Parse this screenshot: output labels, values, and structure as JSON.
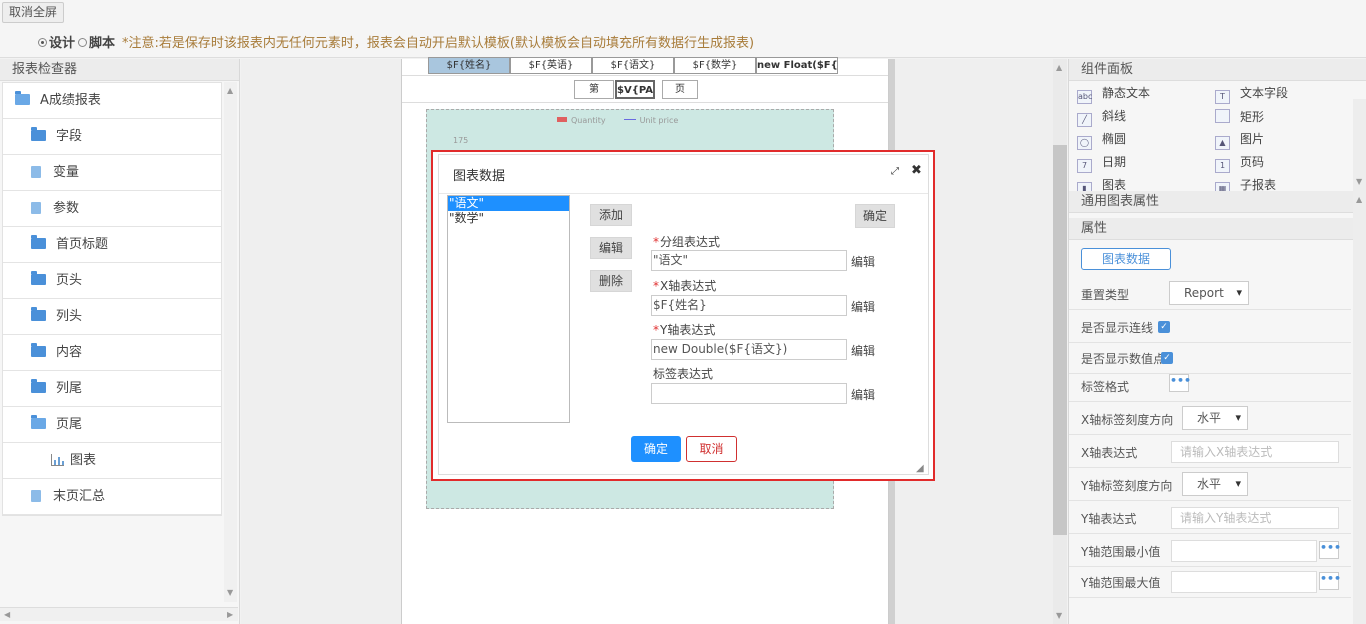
{
  "topbar": {
    "exit_fullscreen": "取消全屏",
    "mode_design": "设计",
    "mode_script": "脚本",
    "notice": "*注意:若是保存时该报表内无任何元素时，报表会自动开启默认模板(默认模板会自动填充所有数据行生成报表)"
  },
  "inspector": {
    "title": "报表检查器",
    "items": [
      {
        "label": "A成绩报表",
        "icon": "folder-open-icon",
        "level": 0
      },
      {
        "label": "字段",
        "icon": "folder-icon",
        "level": 1
      },
      {
        "label": "变量",
        "icon": "file-icon",
        "level": 1
      },
      {
        "label": "参数",
        "icon": "file-icon",
        "level": 1
      },
      {
        "label": "首页标题",
        "icon": "folder-icon",
        "level": 1
      },
      {
        "label": "页头",
        "icon": "folder-icon",
        "level": 1
      },
      {
        "label": "列头",
        "icon": "folder-icon",
        "level": 1
      },
      {
        "label": "内容",
        "icon": "folder-icon",
        "level": 1
      },
      {
        "label": "列尾",
        "icon": "folder-icon",
        "level": 1
      },
      {
        "label": "页尾",
        "icon": "folder-open-icon",
        "level": 1
      },
      {
        "label": "图表",
        "icon": "chart-icon",
        "level": 2
      },
      {
        "label": "末页汇总",
        "icon": "file-icon",
        "level": 1
      }
    ]
  },
  "canvas": {
    "columns": [
      "$F{姓名}",
      "$F{英语}",
      "$F{语文}",
      "$F{数学}",
      "new Float($F{语"
    ],
    "footer": {
      "prefix": "第",
      "page_var": "$V{PAGE",
      "suffix": "页"
    },
    "legend": {
      "quantity": "Quantity",
      "unit_price": "Unit price"
    },
    "axis_tick": "175"
  },
  "components": {
    "title": "组件面板",
    "items": [
      {
        "label": "静态文本",
        "icon": "static-text-icon",
        "glyph": "abc"
      },
      {
        "label": "文本字段",
        "icon": "text-field-icon",
        "glyph": "T"
      },
      {
        "label": "斜线",
        "icon": "line-icon",
        "glyph": "╱"
      },
      {
        "label": "矩形",
        "icon": "rectangle-icon",
        "glyph": ""
      },
      {
        "label": "椭圆",
        "icon": "ellipse-icon",
        "glyph": "◯"
      },
      {
        "label": "图片",
        "icon": "image-icon",
        "glyph": "▲"
      },
      {
        "label": "日期",
        "icon": "date-icon",
        "glyph": "7"
      },
      {
        "label": "页码",
        "icon": "page-number-icon",
        "glyph": "1"
      },
      {
        "label": "图表",
        "icon": "chart-icon",
        "glyph": "▮"
      },
      {
        "label": "子报表",
        "icon": "subreport-icon",
        "glyph": "▦"
      }
    ]
  },
  "properties": {
    "section_general": "通用图表属性",
    "section_props": "属性",
    "chart_data_button": "图表数据",
    "rows": [
      {
        "label": "重置类型",
        "type": "select",
        "value": "Report"
      },
      {
        "label": "是否显示连线",
        "type": "checkbox",
        "checked": true
      },
      {
        "label": "是否显示数值点",
        "type": "checkbox",
        "checked": true
      },
      {
        "label": "标签格式",
        "type": "dots"
      },
      {
        "label": "X轴标签刻度方向",
        "type": "select",
        "value": "水平"
      },
      {
        "label": "X轴表达式",
        "type": "input",
        "placeholder": "请输入X轴表达式"
      },
      {
        "label": "Y轴标签刻度方向",
        "type": "select",
        "value": "水平"
      },
      {
        "label": "Y轴表达式",
        "type": "input",
        "placeholder": "请输入Y轴表达式"
      },
      {
        "label": "Y轴范围最小值",
        "type": "input-dots",
        "placeholder": ""
      },
      {
        "label": "Y轴范围最大值",
        "type": "input-dots",
        "placeholder": ""
      }
    ]
  },
  "dialog": {
    "title": "图表数据",
    "series": [
      "\"语文\"",
      "\"数学\""
    ],
    "selected_series": 0,
    "add": "添加",
    "edit": "编辑",
    "delete": "删除",
    "confirm_top": "确定",
    "fields": [
      {
        "label": "分组表达式",
        "required": true,
        "value": "\"语文\"",
        "edit": "编辑"
      },
      {
        "label": "X轴表达式",
        "required": true,
        "value": "$F{姓名}",
        "edit": "编辑"
      },
      {
        "label": "Y轴表达式",
        "required": true,
        "value": "new Double($F{语文})",
        "edit": "编辑"
      },
      {
        "label": "标签表达式",
        "required": false,
        "value": "",
        "edit": "编辑"
      }
    ],
    "ok": "确定",
    "cancel": "取消"
  },
  "colors": {
    "accent": "#1e90ff",
    "highlight_border": "#e12b2b",
    "folder": "#4a90d9"
  }
}
